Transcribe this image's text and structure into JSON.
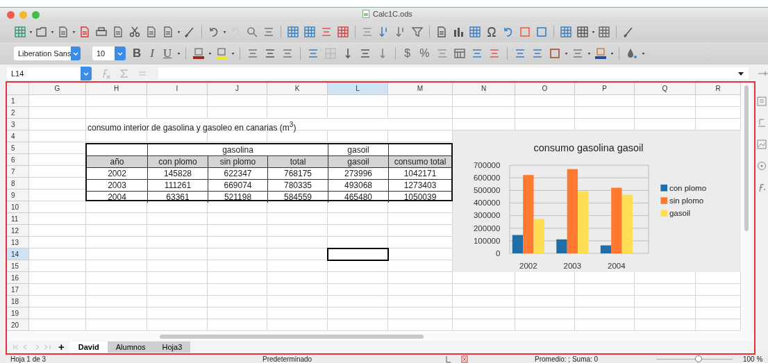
{
  "window": {
    "title": "Calc1C.ods"
  },
  "format_bar": {
    "font_name": "Liberation Sans",
    "font_size": "10",
    "style_buttons": [
      "B",
      "I",
      "U"
    ],
    "number_buttons": [
      "$",
      "%"
    ]
  },
  "formula_bar": {
    "name_box": "L14"
  },
  "sheet": {
    "columns": [
      {
        "label": "G",
        "selected": false
      },
      {
        "label": "H",
        "selected": false
      },
      {
        "label": "I",
        "selected": false
      },
      {
        "label": "J",
        "selected": false
      },
      {
        "label": "K",
        "selected": false
      },
      {
        "label": "L",
        "selected": true
      },
      {
        "label": "M",
        "selected": false
      },
      {
        "label": "N",
        "selected": false
      },
      {
        "label": "O",
        "selected": false
      },
      {
        "label": "P",
        "selected": false
      },
      {
        "label": "Q",
        "selected": false
      },
      {
        "label": "R",
        "selected": false
      }
    ],
    "rows": [
      {
        "label": "1",
        "selected": false
      },
      {
        "label": "2",
        "selected": false
      },
      {
        "label": "3",
        "selected": false
      },
      {
        "label": "4",
        "selected": false
      },
      {
        "label": "5",
        "selected": false
      },
      {
        "label": "6",
        "selected": false
      },
      {
        "label": "7",
        "selected": false
      },
      {
        "label": "8",
        "selected": false
      },
      {
        "label": "9",
        "selected": false
      },
      {
        "label": "10",
        "selected": false
      },
      {
        "label": "11",
        "selected": false
      },
      {
        "label": "12",
        "selected": false
      },
      {
        "label": "13",
        "selected": false
      },
      {
        "label": "14",
        "selected": true
      },
      {
        "label": "15",
        "selected": false
      },
      {
        "label": "16",
        "selected": false
      },
      {
        "label": "17",
        "selected": false
      },
      {
        "label": "18",
        "selected": false
      },
      {
        "label": "19",
        "selected": false
      },
      {
        "label": "20",
        "selected": false
      }
    ]
  },
  "sheet_title": "consumo interior de gasolina y gasoleo en canarias (m$^{3}$)",
  "data_table": {
    "group_headers": [
      "gasolina",
      "gasoil"
    ],
    "headers": [
      "año",
      "con plomo",
      "sin plomo",
      "total",
      "gasoil",
      "consumo total"
    ],
    "rows": [
      [
        "2002",
        "145828",
        "622347",
        "768175",
        "273996",
        "1042171"
      ],
      [
        "2003",
        "111261",
        "669074",
        "780335",
        "493068",
        "1273403"
      ],
      [
        "2004",
        "63361",
        "521198",
        "584559",
        "465480",
        "1050039"
      ]
    ]
  },
  "chart": {
    "chart_data": {
      "type": "bar",
      "title": "consumo gasolina gasoil",
      "categories": [
        "2002",
        "2003",
        "2004"
      ],
      "series": [
        {
          "name": "con plomo",
          "color": "#1f6ea8",
          "values": [
            145828,
            111261,
            63361
          ]
        },
        {
          "name": "sin plomo",
          "color": "#ff7a30",
          "values": [
            622347,
            669074,
            521198
          ]
        },
        {
          "name": "gasoil",
          "color": "#ffdd55",
          "values": [
            273996,
            493068,
            465480
          ]
        }
      ],
      "grid": true,
      "legend": "right",
      "ylim": [
        0,
        700000
      ],
      "yticks": [
        0,
        100000,
        200000,
        300000,
        400000,
        500000,
        600000,
        700000
      ]
    }
  },
  "sheet_tabs": [
    {
      "label": "David",
      "selected": true
    },
    {
      "label": "Alumnos",
      "selected": false
    },
    {
      "label": "Hoja3",
      "selected": false
    }
  ],
  "add_sheet": "+",
  "status_bar": {
    "sheet_count": "Hoja 1 de 3",
    "page_style": "Predeterminado",
    "summary": "Promedio: ; Suma: 0",
    "zoom": {
      "level": 0.55
    },
    "zoom_percent": "100 %"
  }
}
